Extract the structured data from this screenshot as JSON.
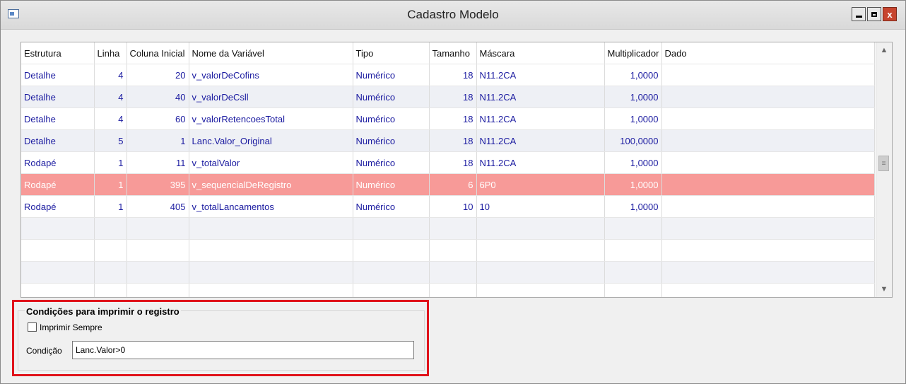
{
  "window": {
    "title": "Cadastro Modelo",
    "close_symbol": "x"
  },
  "grid": {
    "columns": [
      "Estrutura",
      "Linha",
      "Coluna Inicial",
      "Nome da Variável",
      "Tipo",
      "Tamanho",
      "Máscara",
      "Multiplicador",
      "Dado"
    ],
    "rows": [
      {
        "estrutura": "Detalhe",
        "linha": "4",
        "coluna": "20",
        "nome": "v_valorDeCofins",
        "tipo": "Numérico",
        "tamanho": "18",
        "mascara": "N11.2CA",
        "multiplicador": "1,0000",
        "dado": ""
      },
      {
        "estrutura": "Detalhe",
        "linha": "4",
        "coluna": "40",
        "nome": "v_valorDeCsll",
        "tipo": "Numérico",
        "tamanho": "18",
        "mascara": "N11.2CA",
        "multiplicador": "1,0000",
        "dado": ""
      },
      {
        "estrutura": "Detalhe",
        "linha": "4",
        "coluna": "60",
        "nome": "v_valorRetencoesTotal",
        "tipo": "Numérico",
        "tamanho": "18",
        "mascara": "N11.2CA",
        "multiplicador": "1,0000",
        "dado": ""
      },
      {
        "estrutura": "Detalhe",
        "linha": "5",
        "coluna": "1",
        "nome": "Lanc.Valor_Original",
        "tipo": "Numérico",
        "tamanho": "18",
        "mascara": "N11.2CA",
        "multiplicador": "100,0000",
        "dado": ""
      },
      {
        "estrutura": "Rodapé",
        "linha": "1",
        "coluna": "11",
        "nome": "v_totalValor",
        "tipo": "Numérico",
        "tamanho": "18",
        "mascara": "N11.2CA",
        "multiplicador": "1,0000",
        "dado": ""
      },
      {
        "estrutura": "Rodapé",
        "linha": "1",
        "coluna": "395",
        "nome": "v_sequencialDeRegistro",
        "tipo": "Numérico",
        "tamanho": "6",
        "mascara": "6P0",
        "multiplicador": "1,0000",
        "dado": ""
      },
      {
        "estrutura": "Rodapé",
        "linha": "1",
        "coluna": "405",
        "nome": "v_totalLancamentos",
        "tipo": "Numérico",
        "tamanho": "10",
        "mascara": "10",
        "multiplicador": "1,0000",
        "dado": ""
      }
    ],
    "selected_row_index": 5,
    "empty_rows": 4
  },
  "conditions": {
    "group_title": "Condições para imprimir o registro",
    "checkbox_label": "Imprimir Sempre",
    "checkbox_checked": false,
    "condition_label": "Condição",
    "condition_value": "Lanc.Valor>0"
  },
  "colors": {
    "selected_row": "#f79a98",
    "row_text": "#1a1aa0",
    "highlight_border": "#e0131b"
  }
}
